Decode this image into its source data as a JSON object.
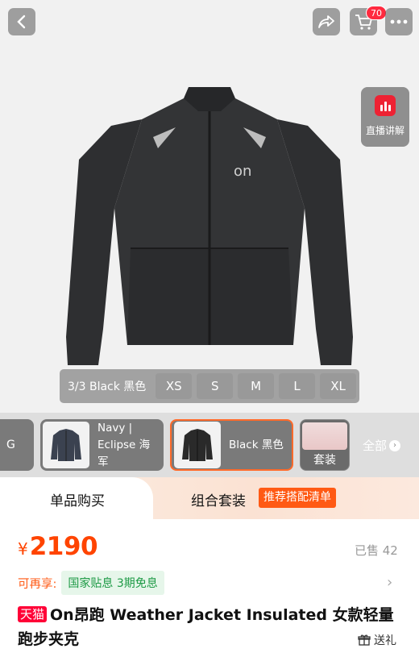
{
  "header": {
    "cart_count": "70"
  },
  "live": {
    "label": "直播讲解"
  },
  "size_selector": {
    "variant_label": "3/3 Black 黑色",
    "sizes": [
      "XS",
      "S",
      "M",
      "L",
      "XL"
    ]
  },
  "thumbnails": {
    "cut_text": "G",
    "navy_label": "Navy | Eclipse 海军",
    "black_label": "Black 黑色",
    "set_label": "套装",
    "all_label": "全部"
  },
  "tabs": {
    "single": "单品购买",
    "combo": "组合套装",
    "recommend": "推荐搭配清单"
  },
  "price": {
    "currency": "¥",
    "value": "2190",
    "sold": "已售 42"
  },
  "promo": {
    "prefix": "可再享:",
    "tag": "国家贴息 3期免息"
  },
  "product": {
    "store_badge": "天猫",
    "title": "On昂跑 Weather Jacket Insulated 女款轻量跑步夹克",
    "gift": "送礼"
  },
  "colors": {
    "accent": "#ff4400",
    "tmall_red": "#ff0036",
    "promo_green": "#1d9a45",
    "recommend_orange": "#ff5a14"
  }
}
